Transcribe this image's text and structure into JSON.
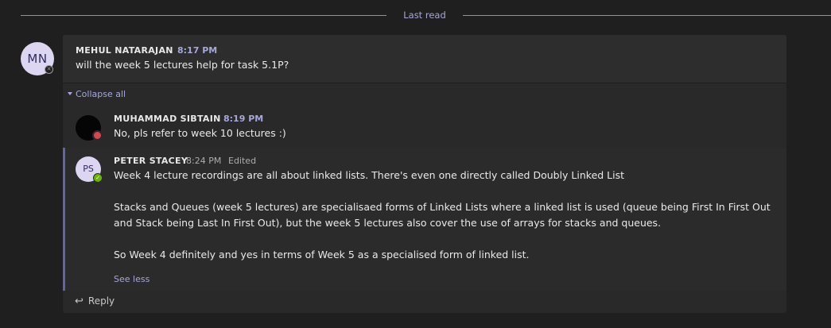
{
  "divider": {
    "label": "Last read"
  },
  "thread": {
    "root": {
      "avatar_initials": "MN",
      "author": "MEHUL NATARAJAN",
      "time": "8:17 PM",
      "text": "will the week 5 lectures help for task 5.1P?"
    },
    "collapse_label": "Collapse all",
    "replies": [
      {
        "author": "MUHAMMAD SIBTAIN",
        "time": "8:19 PM",
        "text": "No, pls refer to week 10 lectures :)"
      },
      {
        "avatar_initials": "PS",
        "author": "PETER STACEY",
        "time": "8:24 PM",
        "edited": "Edited",
        "paragraphs": [
          "Week 4 lecture recordings are all about linked lists. There's even one directly called Doubly Linked List",
          "Stacks and Queues (week 5 lectures) are specialisaed forms of Linked Lists where a linked list is used (queue being First In First Out",
          "and Stack being Last In First Out), but the week 5 lectures also cover the use of arrays for stacks and queues.",
          "So Week 4 definitely and yes in terms of Week 5 as a specialised form of linked list."
        ],
        "see_less": "See less"
      }
    ],
    "reply_label": "Reply"
  },
  "colors": {
    "accent": "#6264a7",
    "accent_text": "#a6a7dc",
    "busy": "#d9454e",
    "available": "#6bb700",
    "background": "#1f1f1f",
    "card": "#292929"
  },
  "icons": {
    "collapse": "caret-down-icon",
    "reply": "reply-arrow-icon",
    "offline": "offline-presence-icon",
    "busy": "busy-presence-icon",
    "available": "available-presence-icon"
  }
}
